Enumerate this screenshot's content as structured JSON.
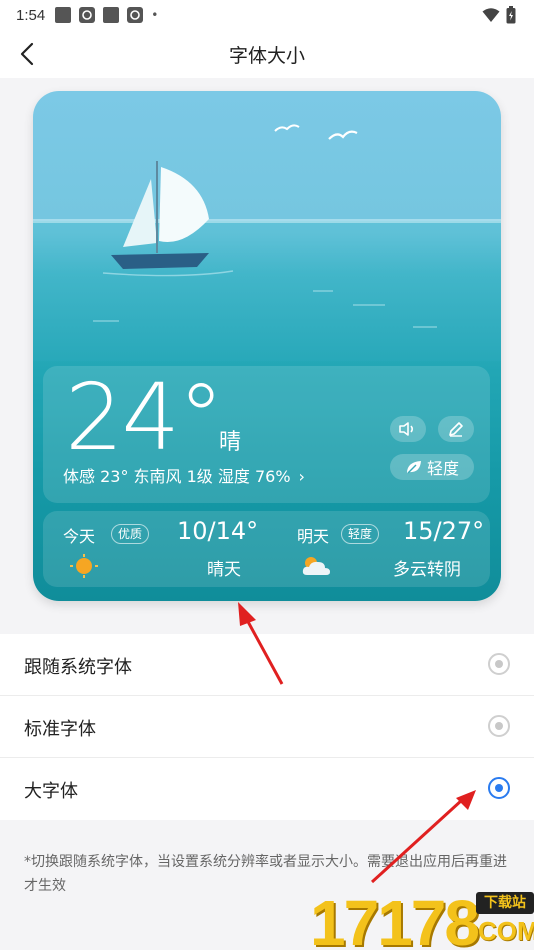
{
  "status_bar": {
    "time": "1:54",
    "dot": "•"
  },
  "header": {
    "title": "字体大小",
    "back_icon": "chevron-left-icon"
  },
  "preview": {
    "temperature": "24°",
    "condition": "晴",
    "details": "体感 23°  东南风 1级  湿度 76%",
    "chevron": "›",
    "air_quality_tag": "轻度",
    "forecast": [
      {
        "day": "今天",
        "badge": "优质",
        "range": "10/14°",
        "desc": "晴天",
        "icon": "sun-icon"
      },
      {
        "day": "明天",
        "badge": "轻度",
        "range": "15/27°",
        "desc": "多云转阴",
        "icon": "cloudy-icon"
      }
    ]
  },
  "options": [
    {
      "label": "跟随系统字体",
      "selected": false
    },
    {
      "label": "标准字体",
      "selected": false
    },
    {
      "label": "大字体",
      "selected": true
    }
  ],
  "note": "*切换跟随系统字体，当设置系统分辨率或者显示大小。需要退出应用后再重进才生效",
  "watermark": {
    "number": "17178",
    "tag": "下载站",
    "suffix": "COM"
  },
  "colors": {
    "accent": "#2a7bef",
    "annotation_arrow": "#e02020",
    "watermark": "#f3c21b"
  }
}
